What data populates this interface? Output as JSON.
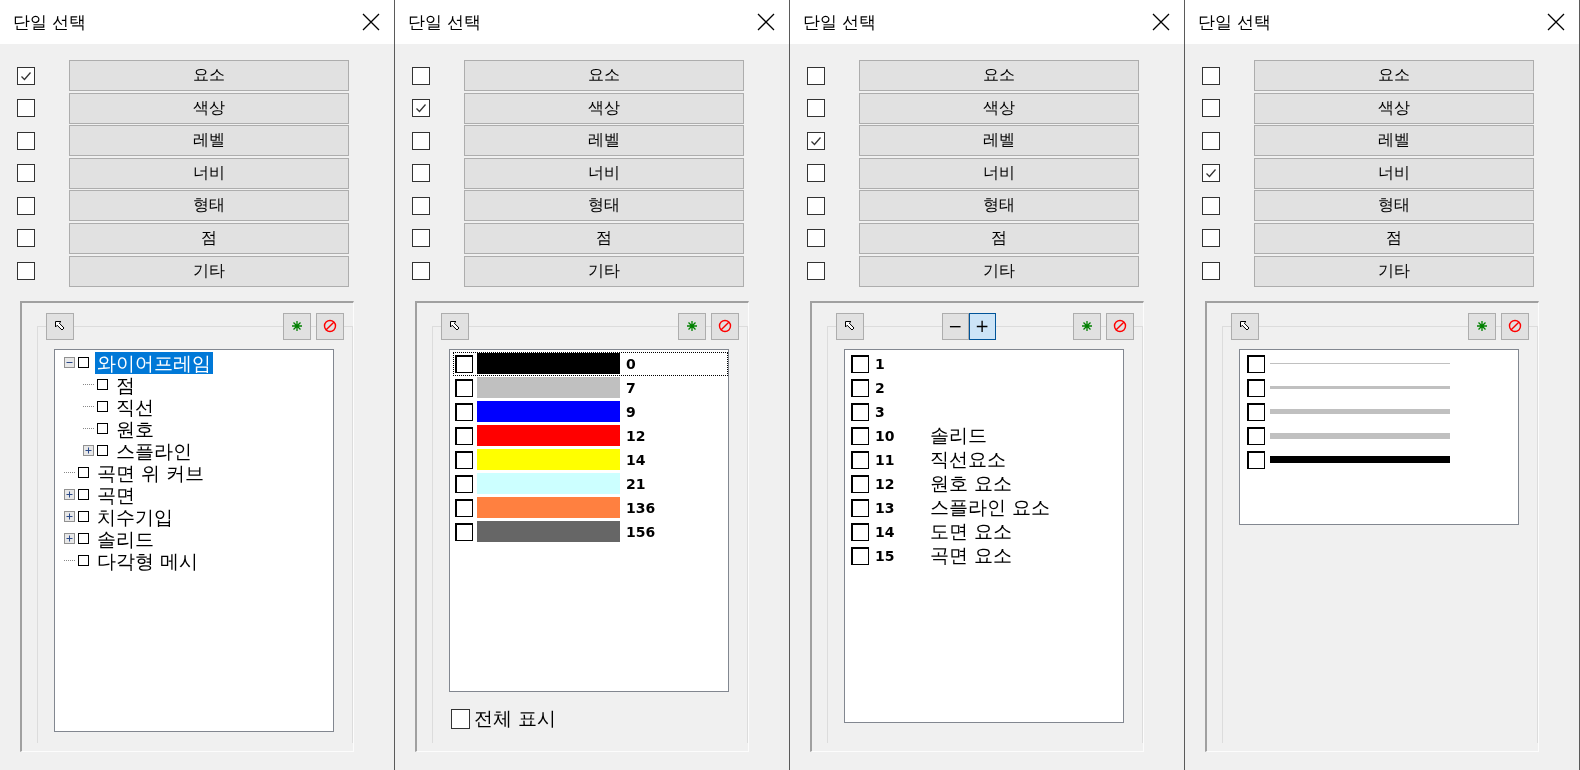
{
  "panels": [
    {
      "title": "단일 선택",
      "filters": [
        {
          "label": "요소",
          "checked": true
        },
        {
          "label": "색상",
          "checked": false
        },
        {
          "label": "레벨",
          "checked": false
        },
        {
          "label": "너비",
          "checked": false
        },
        {
          "label": "형태",
          "checked": false
        },
        {
          "label": "점",
          "checked": false
        },
        {
          "label": "기타",
          "checked": false
        }
      ],
      "content": {
        "kind": "tree",
        "items": [
          {
            "label": "와이어프레임",
            "checked": false,
            "selected": true,
            "expanded": true,
            "children": [
              {
                "label": "점",
                "checked": false,
                "selected": false
              },
              {
                "label": "직선",
                "checked": false,
                "selected": false
              },
              {
                "label": "원호",
                "checked": false,
                "selected": false
              },
              {
                "label": "스플라인",
                "checked": false,
                "selected": false,
                "expanded": false
              }
            ]
          },
          {
            "label": "곡면 위 커브",
            "checked": false,
            "selected": false
          },
          {
            "label": "곡면",
            "checked": false,
            "selected": false,
            "expanded": false
          },
          {
            "label": "치수기입",
            "checked": false,
            "selected": false,
            "expanded": false
          },
          {
            "label": "솔리드",
            "checked": false,
            "selected": false,
            "expanded": false
          },
          {
            "label": "다각형 메시",
            "checked": false,
            "selected": false
          }
        ]
      }
    },
    {
      "title": "단일 선택",
      "filters": [
        {
          "label": "요소",
          "checked": false
        },
        {
          "label": "색상",
          "checked": true
        },
        {
          "label": "레벨",
          "checked": false
        },
        {
          "label": "너비",
          "checked": false
        },
        {
          "label": "형태",
          "checked": false
        },
        {
          "label": "점",
          "checked": false
        },
        {
          "label": "기타",
          "checked": false
        }
      ],
      "content": {
        "kind": "colors",
        "items": [
          {
            "value": "0",
            "color": "#000000",
            "checked": false,
            "focused": true
          },
          {
            "value": "7",
            "color": "#c0c0c0",
            "checked": false,
            "focused": false
          },
          {
            "value": "9",
            "color": "#0000ff",
            "checked": false,
            "focused": false
          },
          {
            "value": "12",
            "color": "#ff0000",
            "checked": false,
            "focused": false
          },
          {
            "value": "14",
            "color": "#ffff00",
            "checked": false,
            "focused": false
          },
          {
            "value": "21",
            "color": "#ccffff",
            "checked": false,
            "focused": false
          },
          {
            "value": "136",
            "color": "#ff8040",
            "checked": false,
            "focused": false
          },
          {
            "value": "156",
            "color": "#666666",
            "checked": false,
            "focused": false
          }
        ],
        "show_all": {
          "label": "전체 표시",
          "checked": false
        }
      }
    },
    {
      "title": "단일 선택",
      "filters": [
        {
          "label": "요소",
          "checked": false
        },
        {
          "label": "색상",
          "checked": false
        },
        {
          "label": "레벨",
          "checked": true
        },
        {
          "label": "너비",
          "checked": false
        },
        {
          "label": "형태",
          "checked": false
        },
        {
          "label": "점",
          "checked": false
        },
        {
          "label": "기타",
          "checked": false
        }
      ],
      "steppers": [
        {
          "label": "−",
          "active": false
        },
        {
          "label": "+",
          "active": true
        }
      ],
      "content": {
        "kind": "levels",
        "items": [
          {
            "number": "1",
            "checked": false
          },
          {
            "number": "2",
            "checked": false
          },
          {
            "number": "3",
            "checked": false
          },
          {
            "number": "10",
            "name": "솔리드",
            "checked": false
          },
          {
            "number": "11",
            "name": "직선요소",
            "checked": false
          },
          {
            "number": "12",
            "name": "원호 요소",
            "checked": false
          },
          {
            "number": "13",
            "name": "스플라인 요소",
            "checked": false
          },
          {
            "number": "14",
            "name": "도면 요소",
            "checked": false
          },
          {
            "number": "15",
            "name": "곡면 요소",
            "checked": false
          }
        ]
      }
    },
    {
      "title": "단일 선택",
      "filters": [
        {
          "label": "요소",
          "checked": false
        },
        {
          "label": "색상",
          "checked": false
        },
        {
          "label": "레벨",
          "checked": false
        },
        {
          "label": "너비",
          "checked": true
        },
        {
          "label": "형태",
          "checked": false
        },
        {
          "label": "점",
          "checked": false
        },
        {
          "label": "기타",
          "checked": false
        }
      ],
      "content": {
        "kind": "widths",
        "items": [
          {
            "kind": "hairline",
            "color": "#c0c0c0",
            "checked": false
          },
          {
            "kind": "thin",
            "color": "#c0c0c0",
            "checked": false
          },
          {
            "kind": "medium",
            "color": "#c0c0c0",
            "checked": false
          },
          {
            "kind": "bold",
            "color": "#c0c0c0",
            "checked": false
          },
          {
            "kind": "heavy",
            "color": "#000000",
            "checked": false
          }
        ]
      }
    }
  ]
}
